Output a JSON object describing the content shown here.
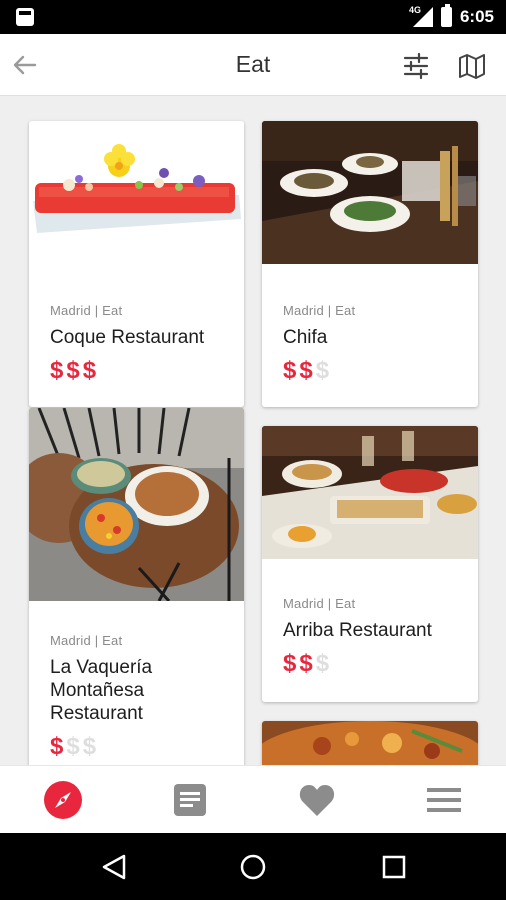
{
  "status_bar": {
    "time": "6:05",
    "network": "4G"
  },
  "app_bar": {
    "title": "Eat"
  },
  "cards": [
    {
      "meta": "Madrid | Eat",
      "name": "Coque Restaurant",
      "price_level": 3,
      "price_max": 3
    },
    {
      "meta": "Madrid | Eat",
      "name": "Chifa",
      "price_level": 2,
      "price_max": 3
    },
    {
      "meta": "Madrid | Eat",
      "name": "La Vaquería Montañesa Restaurant",
      "price_level": 1,
      "price_max": 3
    },
    {
      "meta": "Madrid | Eat",
      "name": "Arriba Restaurant",
      "price_level": 2,
      "price_max": 3
    }
  ],
  "price_symbol": "$",
  "colors": {
    "accent": "#e8273f",
    "inactive_price": "#dedede",
    "nav_icon": "#8c8c8c"
  },
  "bottom_nav": [
    "compass-icon",
    "articles-icon",
    "heart-icon",
    "menu-icon"
  ]
}
